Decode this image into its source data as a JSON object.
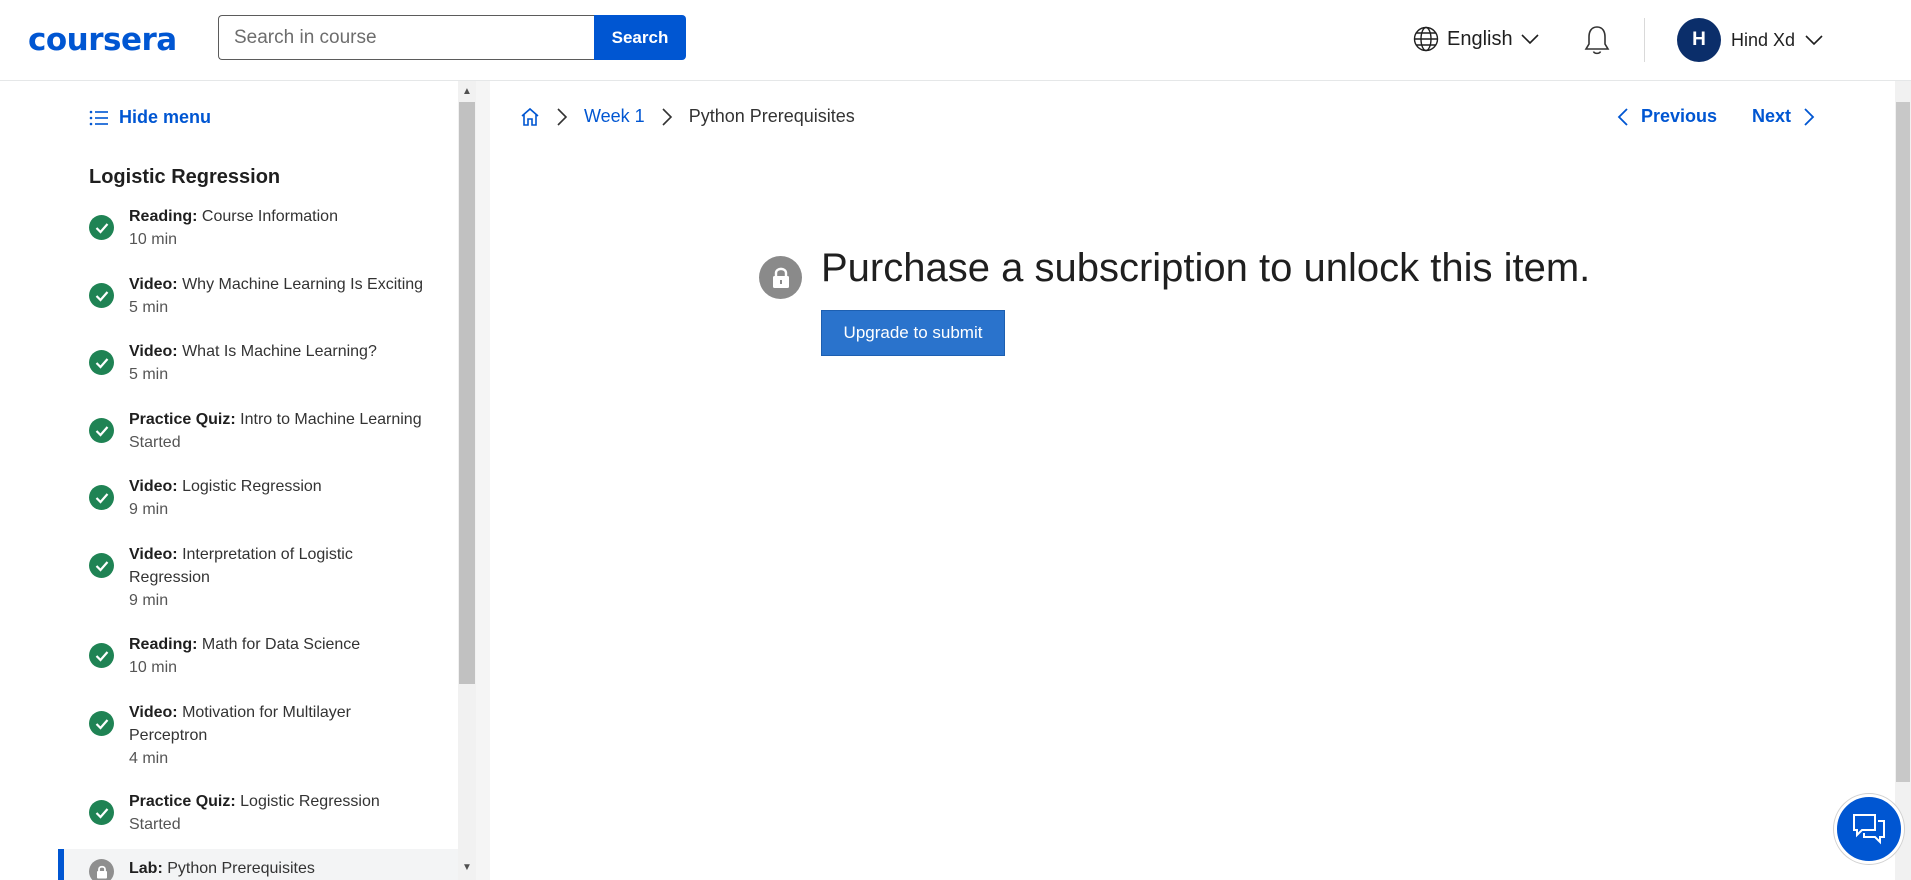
{
  "brand": {
    "logo_text": "coursera",
    "color": "#0056d2"
  },
  "header": {
    "search_placeholder": "Search in course",
    "search_button": "Search",
    "language": "English",
    "user_initial": "H",
    "user_name": "Hind Xd"
  },
  "sidebar": {
    "hide_menu": "Hide menu",
    "module_title": "Logistic Regression",
    "items": [
      {
        "type": "Reading:",
        "title": "Course Information",
        "meta": "10 min",
        "status": "completed"
      },
      {
        "type": "Video:",
        "title": "Why Machine Learning Is Exciting",
        "meta": "5 min",
        "status": "completed"
      },
      {
        "type": "Video:",
        "title": "What Is Machine Learning?",
        "meta": "5 min",
        "status": "completed"
      },
      {
        "type": "Practice Quiz:",
        "title": "Intro to Machine Learning",
        "meta": "Started",
        "status": "completed"
      },
      {
        "type": "Video:",
        "title": "Logistic Regression",
        "meta": "9 min",
        "status": "completed"
      },
      {
        "type": "Video:",
        "title": "Interpretation of Logistic Regression",
        "meta": "9 min",
        "status": "completed"
      },
      {
        "type": "Reading:",
        "title": "Math for Data Science",
        "meta": "10 min",
        "status": "completed"
      },
      {
        "type": "Video:",
        "title": "Motivation for Multilayer Perceptron",
        "meta": "4 min",
        "status": "completed"
      },
      {
        "type": "Practice Quiz:",
        "title": "Logistic Regression",
        "meta": "Started",
        "status": "completed"
      },
      {
        "type": "Lab:",
        "title": "Python Prerequisites",
        "meta": "",
        "status": "locked"
      }
    ]
  },
  "breadcrumb": {
    "week": "Week 1",
    "current": "Python Prerequisites"
  },
  "nav": {
    "previous": "Previous",
    "next": "Next"
  },
  "main": {
    "locked_message": "Purchase a subscription to unlock this item.",
    "upgrade_button": "Upgrade to submit"
  },
  "colors": {
    "accent": "#0056d2",
    "success": "#1f8354",
    "locked": "#8a8a8a"
  }
}
